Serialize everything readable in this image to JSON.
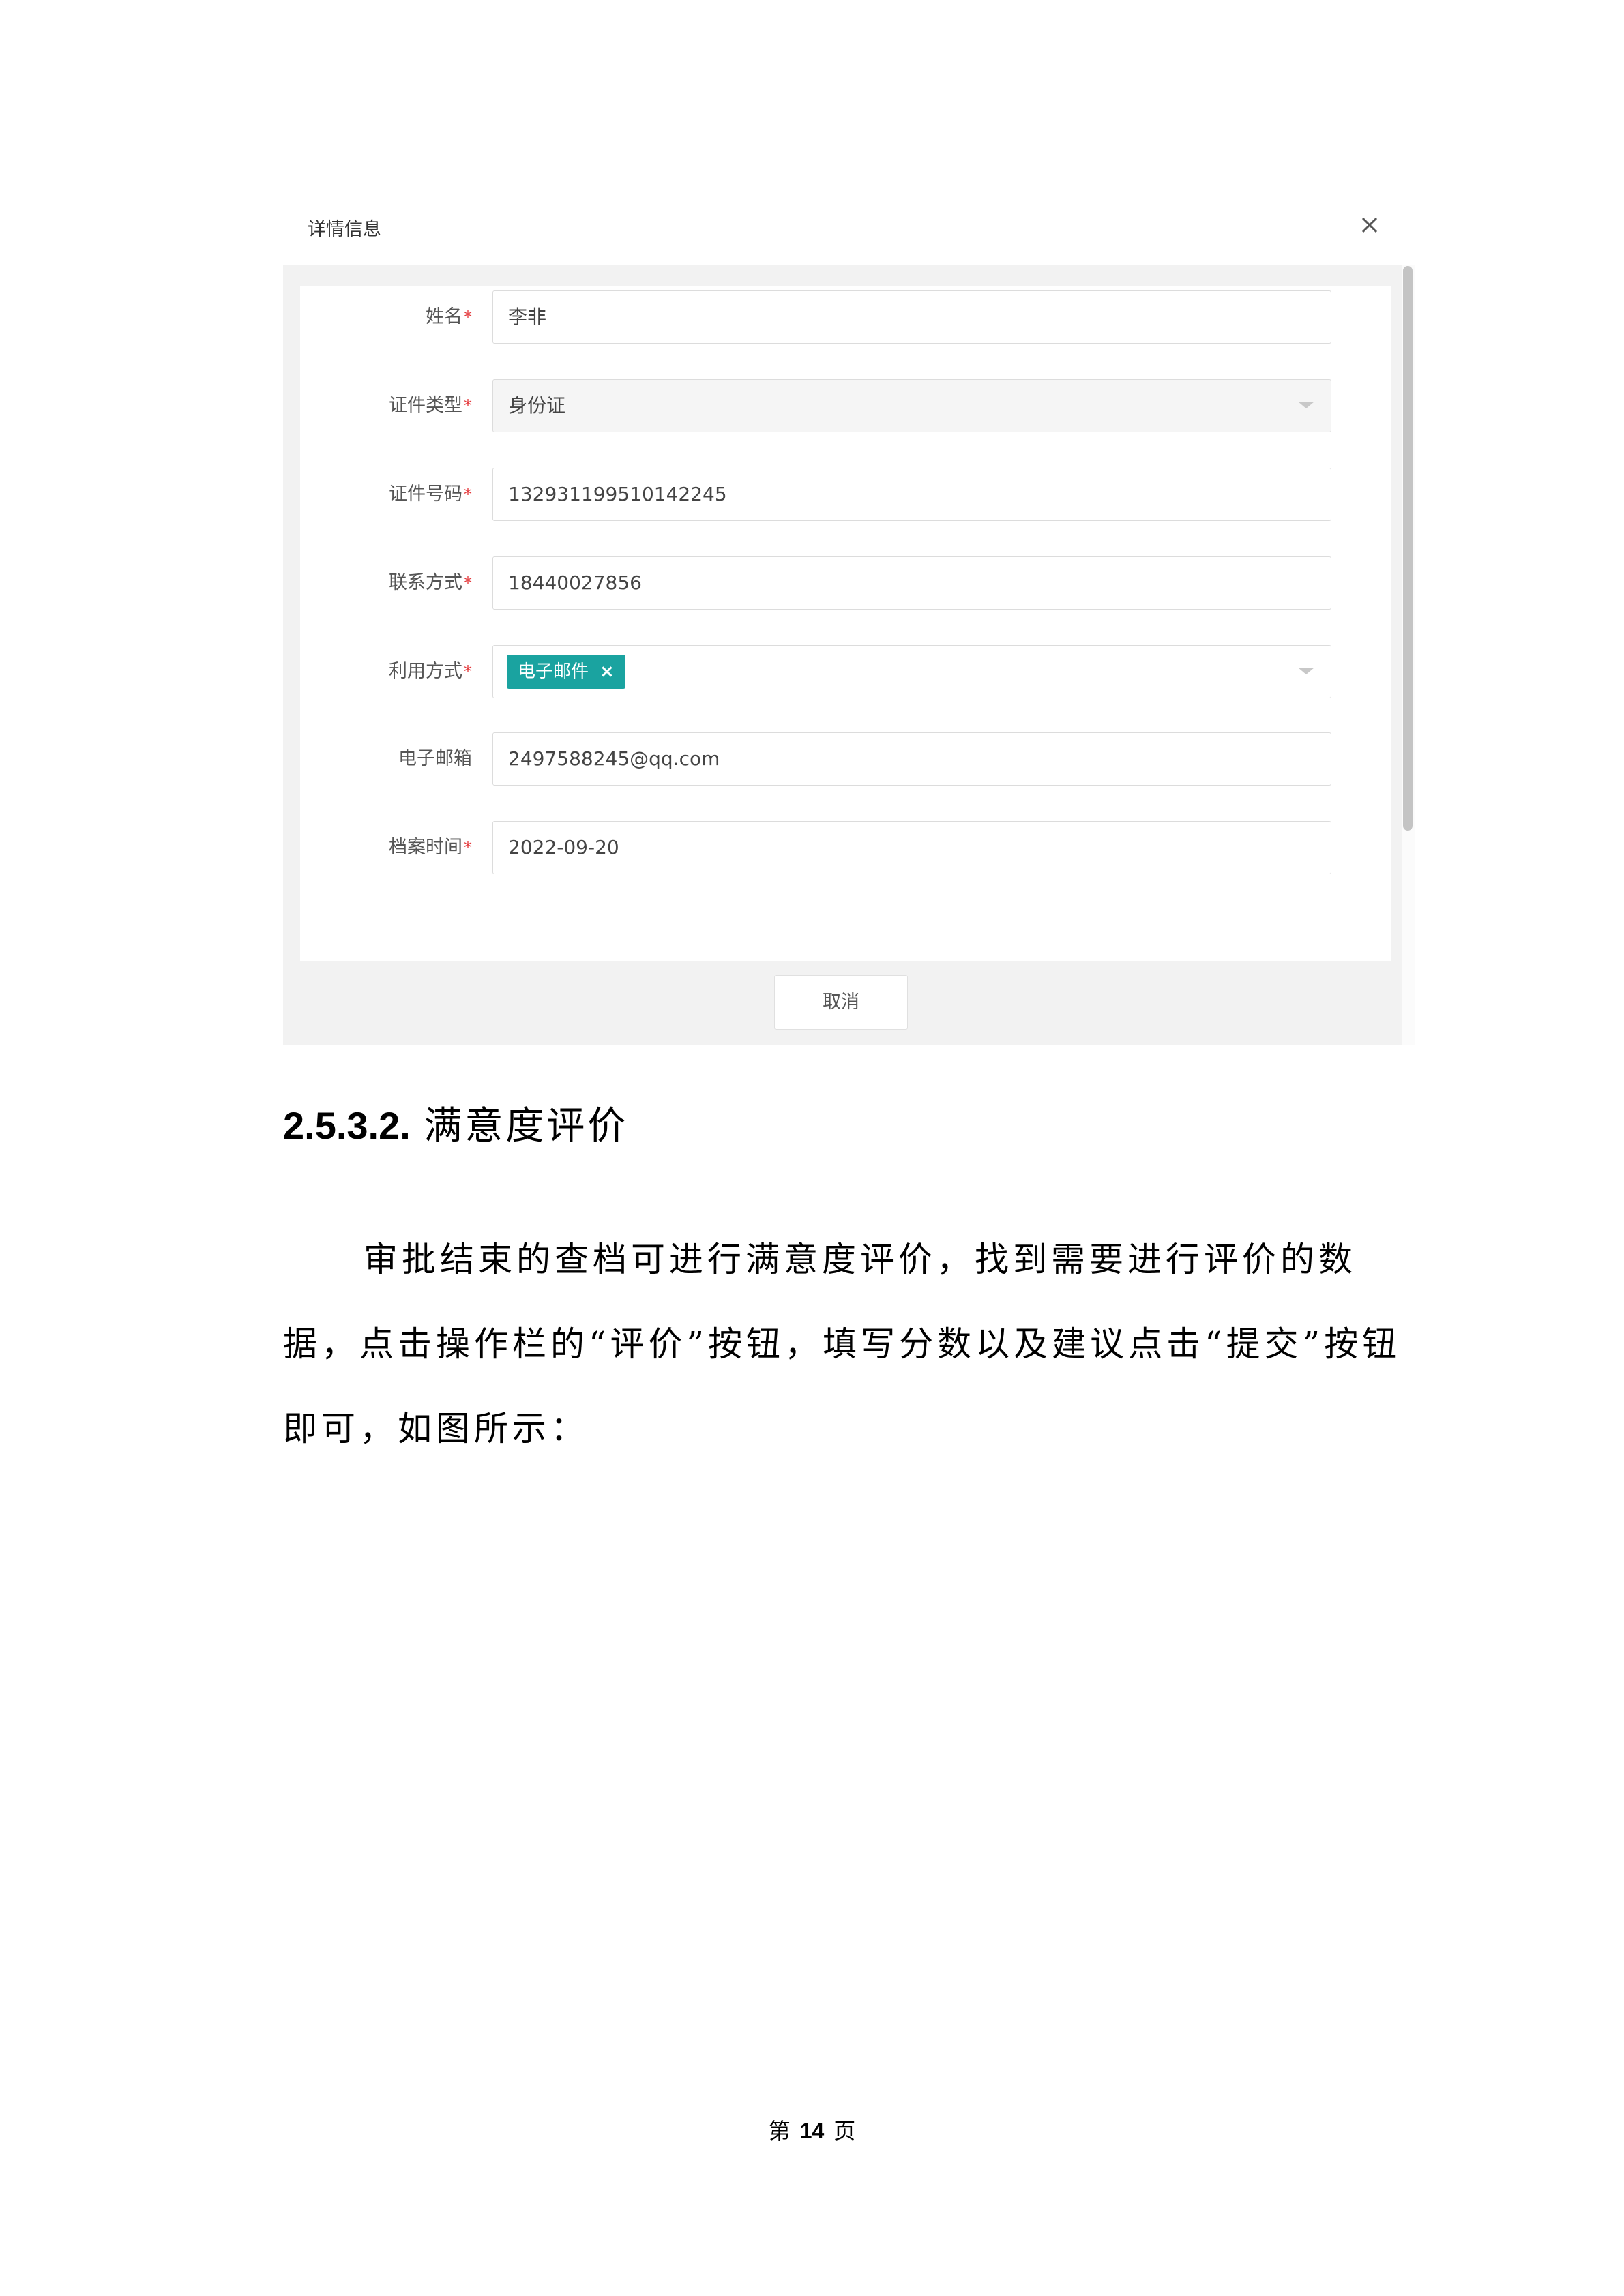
{
  "dialog": {
    "title": "详情信息",
    "close_icon": "close-icon",
    "fields": [
      {
        "label": "姓名",
        "required": true,
        "value": "李非",
        "kind": "text"
      },
      {
        "label": "证件类型",
        "required": true,
        "value": "身份证",
        "kind": "select-disabled"
      },
      {
        "label": "证件号码",
        "required": true,
        "value": "132931199510142245",
        "kind": "text"
      },
      {
        "label": "联系方式",
        "required": true,
        "value": "18440027856",
        "kind": "text"
      },
      {
        "label": "利用方式",
        "required": true,
        "tag": "电子邮件",
        "tag_close": "×",
        "kind": "multiselect"
      },
      {
        "label": "电子邮箱",
        "required": false,
        "value": "2497588245@qq.com",
        "kind": "text"
      },
      {
        "label": "档案时间",
        "required": true,
        "value": "2022-09-20",
        "kind": "text"
      }
    ],
    "required_mark": "*",
    "cancel_label": "取消",
    "tag_color": "#1aa3a0"
  },
  "section": {
    "number": "2.5.3.2.",
    "title": "满意度评价"
  },
  "paragraph": "审批结束的查档可进行满意度评价，找到需要进行评价的数据，点击操作栏的“评价”按钮，填写分数以及建议点击“提交”按钮即可，如图所示：",
  "footer": {
    "prefix": "第",
    "page": "14",
    "suffix": "页"
  }
}
